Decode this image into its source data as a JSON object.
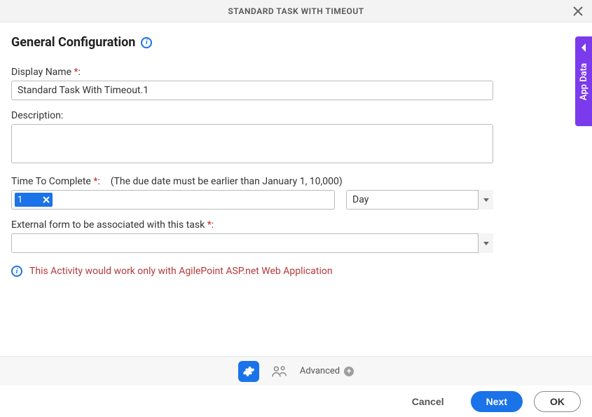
{
  "header": {
    "title": "STANDARD TASK WITH TIMEOUT"
  },
  "section": {
    "title": "General Configuration"
  },
  "fields": {
    "displayName": {
      "label": "Display Name",
      "value": "Standard Task With Timeout.1"
    },
    "description": {
      "label": "Description:",
      "value": ""
    },
    "timeToComplete": {
      "label": "Time To Complete",
      "hint": "(The due date must be earlier than January 1, 10,000)",
      "value": "1",
      "unit": "Day"
    },
    "externalForm": {
      "label": "External form to be associated with this task",
      "value": ""
    }
  },
  "warning": "This Activity would work only with AgilePoint ASP.net Web Application",
  "sideTab": {
    "label": "App Data"
  },
  "toolbar": {
    "advanced": "Advanced"
  },
  "footer": {
    "cancel": "Cancel",
    "next": "Next",
    "ok": "OK"
  }
}
